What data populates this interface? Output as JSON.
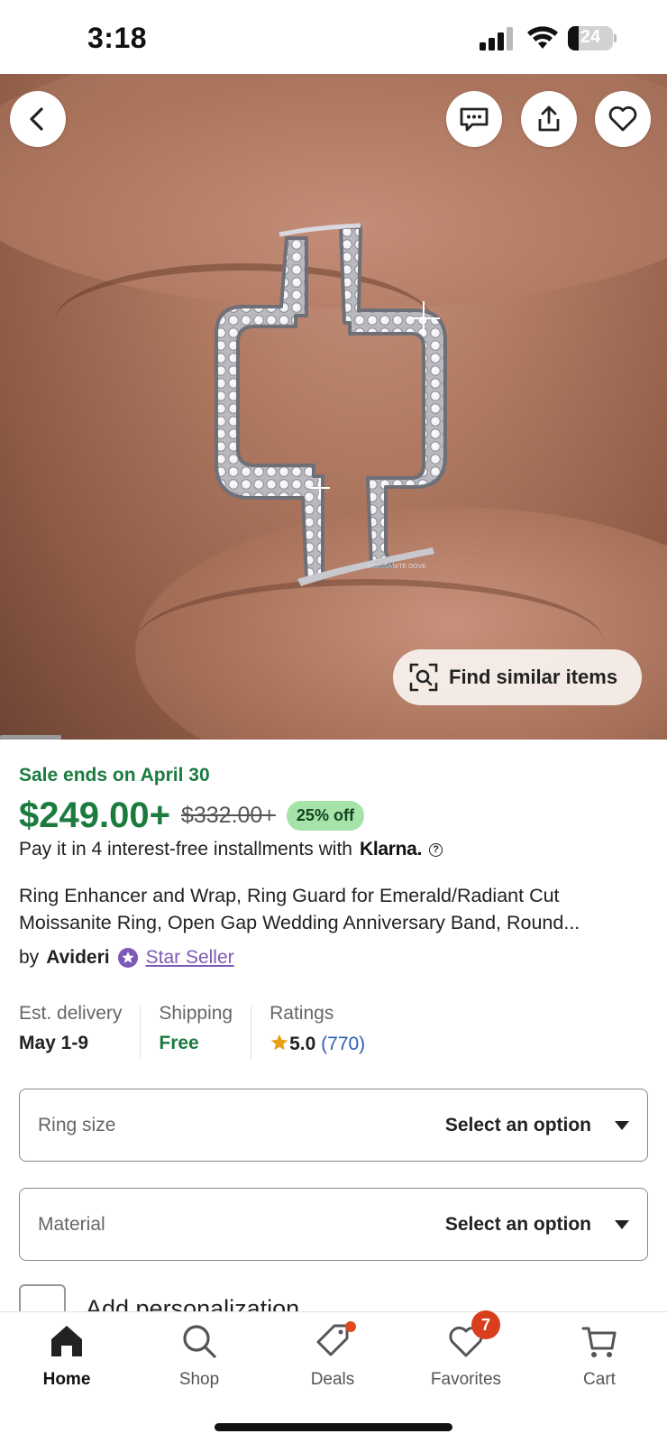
{
  "status_bar": {
    "time": "3:18",
    "battery": "24"
  },
  "image": {
    "find_similar_label": "Find similar items",
    "watermark": "MOISSANITE DOVE"
  },
  "product": {
    "sale_text": "Sale ends on April 30",
    "price": "$249.00+",
    "original_price": "$332.00+",
    "discount": "25% off",
    "installments_text": "Pay it in 4 interest-free installments with",
    "installments_provider": "Klarna.",
    "title": "Ring Enhancer and Wrap, Ring Guard for Emerald/Radiant Cut Moissanite Ring, Open Gap Wedding Anniversary Band, Round...",
    "seller_prefix": "by",
    "seller_name": "Avideri",
    "seller_badge": "Star Seller"
  },
  "info": {
    "delivery_label": "Est. delivery",
    "delivery_value": "May 1-9",
    "shipping_label": "Shipping",
    "shipping_value": "Free",
    "ratings_label": "Ratings",
    "rating_value": "5.0",
    "rating_count": "(770)"
  },
  "options": {
    "ring_size_label": "Ring size",
    "ring_size_value": "Select an option",
    "material_label": "Material",
    "material_value": "Select an option",
    "personalization_label": "Add personalization"
  },
  "nav": {
    "home": "Home",
    "shop": "Shop",
    "deals": "Deals",
    "favorites": "Favorites",
    "favorites_badge": "7",
    "cart": "Cart"
  },
  "colors": {
    "sale_green": "#1b7b3f",
    "discount_bg": "#a6e3a9",
    "star_seller_purple": "#7d5ab5",
    "badge_red": "#d93e1d",
    "rating_count_blue": "#2b5fb0"
  },
  "icons": [
    "back-arrow-icon",
    "message-icon",
    "share-icon",
    "heart-icon",
    "visual-search-icon",
    "star-seller-icon",
    "star-icon",
    "home-icon",
    "search-icon",
    "deals-tag-icon",
    "favorites-heart-icon",
    "cart-icon"
  ]
}
